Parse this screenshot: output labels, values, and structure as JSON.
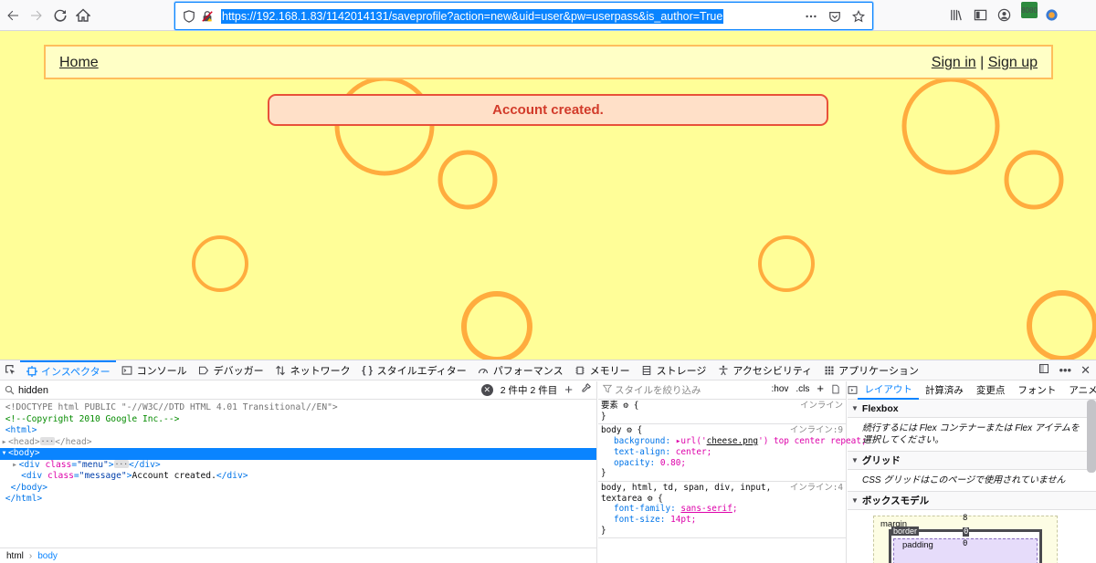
{
  "browser": {
    "url": "https://192.168.1.83/1142014131/saveprofile?action=new&uid=user&pw=userpass&is_author=True",
    "badge": "8080"
  },
  "page": {
    "menu": {
      "home": "Home",
      "sign_in": "Sign in",
      "separator": " | ",
      "sign_up": "Sign up"
    },
    "message": "Account created."
  },
  "devtools": {
    "tabs": [
      {
        "label": "インスペクター",
        "icon": "inspector-icon"
      },
      {
        "label": "コンソール",
        "icon": "console-icon"
      },
      {
        "label": "デバッガー",
        "icon": "debugger-icon"
      },
      {
        "label": "ネットワーク",
        "icon": "network-icon"
      },
      {
        "label": "スタイルエディター",
        "icon": "style-editor-icon"
      },
      {
        "label": "パフォーマンス",
        "icon": "performance-icon"
      },
      {
        "label": "メモリー",
        "icon": "memory-icon"
      },
      {
        "label": "ストレージ",
        "icon": "storage-icon"
      },
      {
        "label": "アクセシビリティ",
        "icon": "accessibility-icon"
      },
      {
        "label": "アプリケーション",
        "icon": "application-icon"
      }
    ],
    "search": {
      "value": "hidden",
      "result": "2 件中 2 件目"
    },
    "markup": {
      "doctype": "<!DOCTYPE html PUBLIC \"-//W3C//DTD HTML 4.01 Transitional//EN\">",
      "comment": "<!--Copyright 2010 Google Inc.-->",
      "message_text": "Account created."
    },
    "breadcrumb": {
      "root": "html",
      "current": "body"
    },
    "rules": {
      "filter_placeholder": "スタイルを絞り込み",
      "hov": ":hov",
      "cls": ".cls",
      "element_label": "要素",
      "inline": "インライン",
      "rule1_source": "インライン:9",
      "rule1_selector": "body",
      "rule1_bg_prop": "background:",
      "rule1_bg_url": "cheese.png",
      "rule1_bg_rest": " top center repeat;",
      "rule1_ta_prop": "text-align:",
      "rule1_ta_val": "center;",
      "rule1_op_prop": "opacity:",
      "rule1_op_val": "0.80;",
      "rule2_source": "インライン:4",
      "rule2_selector_a": "body, html, td, span, div, input,",
      "rule2_selector_b": "textarea",
      "rule2_ff_prop": "font-family:",
      "rule2_ff_val": "sans-serif",
      "rule2_fs_prop": "font-size:",
      "rule2_fs_val": "14pt;"
    },
    "layout": {
      "tabs": [
        "レイアウト",
        "計算済み",
        "変更点",
        "フォント",
        "アニメーション"
      ],
      "flexbox_title": "Flexbox",
      "flexbox_msg": "続行するには Flex コンテナーまたは Flex アイテムを選択してください。",
      "grid_title": "グリッド",
      "grid_msg": "CSS グリッドはこのページで使用されていません",
      "boxmodel_title": "ボックスモデル",
      "margin_label": "margin",
      "margin_val": "8",
      "border_label": "border",
      "border_val": "0",
      "padding_label": "padding",
      "padding_val": "0"
    }
  }
}
